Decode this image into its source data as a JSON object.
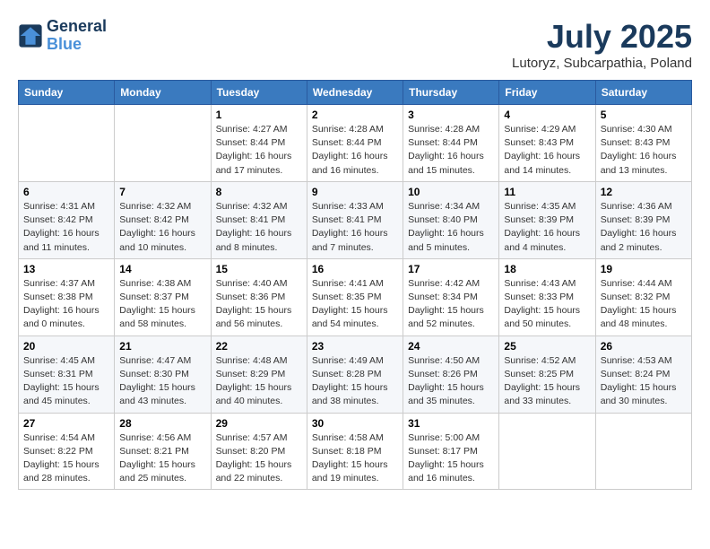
{
  "logo": {
    "line1": "General",
    "line2": "Blue"
  },
  "title": "July 2025",
  "subtitle": "Lutoryz, Subcarpathia, Poland",
  "weekdays": [
    "Sunday",
    "Monday",
    "Tuesday",
    "Wednesday",
    "Thursday",
    "Friday",
    "Saturday"
  ],
  "weeks": [
    [
      {
        "day": "",
        "info": ""
      },
      {
        "day": "",
        "info": ""
      },
      {
        "day": "1",
        "info": "Sunrise: 4:27 AM\nSunset: 8:44 PM\nDaylight: 16 hours and 17 minutes."
      },
      {
        "day": "2",
        "info": "Sunrise: 4:28 AM\nSunset: 8:44 PM\nDaylight: 16 hours and 16 minutes."
      },
      {
        "day": "3",
        "info": "Sunrise: 4:28 AM\nSunset: 8:44 PM\nDaylight: 16 hours and 15 minutes."
      },
      {
        "day": "4",
        "info": "Sunrise: 4:29 AM\nSunset: 8:43 PM\nDaylight: 16 hours and 14 minutes."
      },
      {
        "day": "5",
        "info": "Sunrise: 4:30 AM\nSunset: 8:43 PM\nDaylight: 16 hours and 13 minutes."
      }
    ],
    [
      {
        "day": "6",
        "info": "Sunrise: 4:31 AM\nSunset: 8:42 PM\nDaylight: 16 hours and 11 minutes."
      },
      {
        "day": "7",
        "info": "Sunrise: 4:32 AM\nSunset: 8:42 PM\nDaylight: 16 hours and 10 minutes."
      },
      {
        "day": "8",
        "info": "Sunrise: 4:32 AM\nSunset: 8:41 PM\nDaylight: 16 hours and 8 minutes."
      },
      {
        "day": "9",
        "info": "Sunrise: 4:33 AM\nSunset: 8:41 PM\nDaylight: 16 hours and 7 minutes."
      },
      {
        "day": "10",
        "info": "Sunrise: 4:34 AM\nSunset: 8:40 PM\nDaylight: 16 hours and 5 minutes."
      },
      {
        "day": "11",
        "info": "Sunrise: 4:35 AM\nSunset: 8:39 PM\nDaylight: 16 hours and 4 minutes."
      },
      {
        "day": "12",
        "info": "Sunrise: 4:36 AM\nSunset: 8:39 PM\nDaylight: 16 hours and 2 minutes."
      }
    ],
    [
      {
        "day": "13",
        "info": "Sunrise: 4:37 AM\nSunset: 8:38 PM\nDaylight: 16 hours and 0 minutes."
      },
      {
        "day": "14",
        "info": "Sunrise: 4:38 AM\nSunset: 8:37 PM\nDaylight: 15 hours and 58 minutes."
      },
      {
        "day": "15",
        "info": "Sunrise: 4:40 AM\nSunset: 8:36 PM\nDaylight: 15 hours and 56 minutes."
      },
      {
        "day": "16",
        "info": "Sunrise: 4:41 AM\nSunset: 8:35 PM\nDaylight: 15 hours and 54 minutes."
      },
      {
        "day": "17",
        "info": "Sunrise: 4:42 AM\nSunset: 8:34 PM\nDaylight: 15 hours and 52 minutes."
      },
      {
        "day": "18",
        "info": "Sunrise: 4:43 AM\nSunset: 8:33 PM\nDaylight: 15 hours and 50 minutes."
      },
      {
        "day": "19",
        "info": "Sunrise: 4:44 AM\nSunset: 8:32 PM\nDaylight: 15 hours and 48 minutes."
      }
    ],
    [
      {
        "day": "20",
        "info": "Sunrise: 4:45 AM\nSunset: 8:31 PM\nDaylight: 15 hours and 45 minutes."
      },
      {
        "day": "21",
        "info": "Sunrise: 4:47 AM\nSunset: 8:30 PM\nDaylight: 15 hours and 43 minutes."
      },
      {
        "day": "22",
        "info": "Sunrise: 4:48 AM\nSunset: 8:29 PM\nDaylight: 15 hours and 40 minutes."
      },
      {
        "day": "23",
        "info": "Sunrise: 4:49 AM\nSunset: 8:28 PM\nDaylight: 15 hours and 38 minutes."
      },
      {
        "day": "24",
        "info": "Sunrise: 4:50 AM\nSunset: 8:26 PM\nDaylight: 15 hours and 35 minutes."
      },
      {
        "day": "25",
        "info": "Sunrise: 4:52 AM\nSunset: 8:25 PM\nDaylight: 15 hours and 33 minutes."
      },
      {
        "day": "26",
        "info": "Sunrise: 4:53 AM\nSunset: 8:24 PM\nDaylight: 15 hours and 30 minutes."
      }
    ],
    [
      {
        "day": "27",
        "info": "Sunrise: 4:54 AM\nSunset: 8:22 PM\nDaylight: 15 hours and 28 minutes."
      },
      {
        "day": "28",
        "info": "Sunrise: 4:56 AM\nSunset: 8:21 PM\nDaylight: 15 hours and 25 minutes."
      },
      {
        "day": "29",
        "info": "Sunrise: 4:57 AM\nSunset: 8:20 PM\nDaylight: 15 hours and 22 minutes."
      },
      {
        "day": "30",
        "info": "Sunrise: 4:58 AM\nSunset: 8:18 PM\nDaylight: 15 hours and 19 minutes."
      },
      {
        "day": "31",
        "info": "Sunrise: 5:00 AM\nSunset: 8:17 PM\nDaylight: 15 hours and 16 minutes."
      },
      {
        "day": "",
        "info": ""
      },
      {
        "day": "",
        "info": ""
      }
    ]
  ]
}
